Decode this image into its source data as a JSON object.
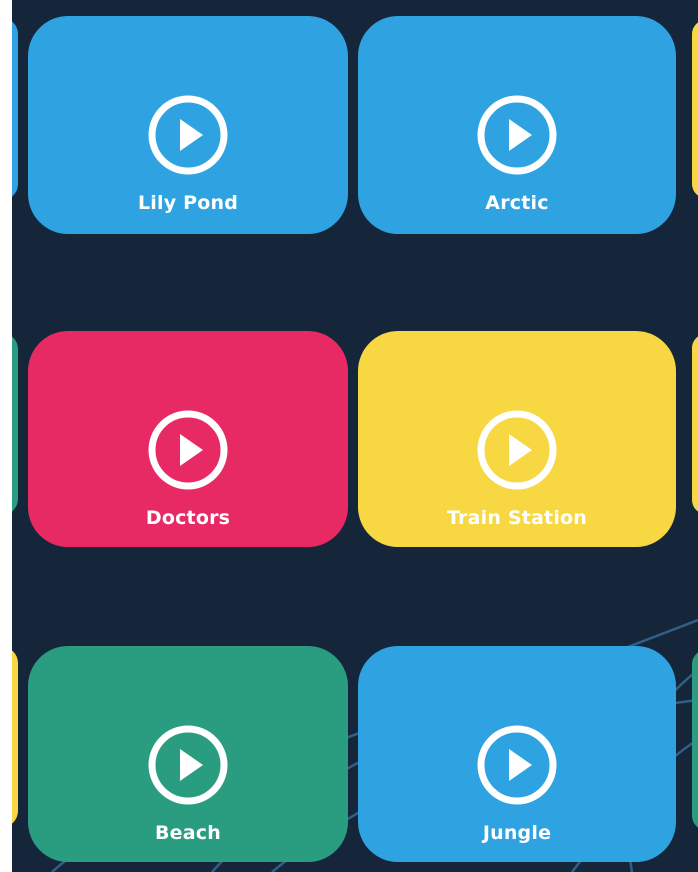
{
  "colors": {
    "background": "#15263a",
    "blue": "#2fa3e2",
    "pink": "#e72a64",
    "yellow": "#f7d843",
    "green": "#2a9c80"
  },
  "tiles": [
    {
      "label": "Lily Pond",
      "color": "#2fa3e2",
      "icon": "play-circle-icon"
    },
    {
      "label": "Arctic",
      "color": "#2fa3e2",
      "icon": "play-circle-icon"
    },
    {
      "label": "Doctors",
      "color": "#e72a64",
      "icon": "play-circle-icon"
    },
    {
      "label": "Train Station",
      "color": "#f7d843",
      "icon": "play-circle-icon"
    },
    {
      "label": "Beach",
      "color": "#2a9c80",
      "icon": "play-circle-icon"
    },
    {
      "label": "Jungle",
      "color": "#2fa3e2",
      "icon": "play-circle-icon"
    }
  ]
}
